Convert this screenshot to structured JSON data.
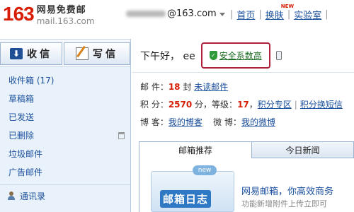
{
  "header": {
    "logo_number": "163",
    "logo_name": "网易免费邮",
    "logo_domain": "mail.163.com",
    "account_domain": "@163.com",
    "links": [
      {
        "label": "首页"
      },
      {
        "label": "换肤",
        "badge": "NEW"
      },
      {
        "label": "实验室"
      }
    ],
    "separator": "|"
  },
  "toolbar": {
    "receive_label": "收信",
    "write_label": "写信"
  },
  "sidebar": {
    "items": [
      {
        "label": "收件箱 (17)"
      },
      {
        "label": "草稿箱"
      },
      {
        "label": "已发送"
      },
      {
        "label": "已删除"
      },
      {
        "label": "垃圾邮件"
      },
      {
        "label": "广告邮件"
      }
    ],
    "contacts_label": "通讯录"
  },
  "main": {
    "greeting": "下午好， ee",
    "security_link": "安全系数高",
    "mail_prefix": "邮 件：",
    "mail_count": "18",
    "mail_unit": " 封 ",
    "unread_link": "未读邮件",
    "points_prefix": "积 分：",
    "points_value": "2570",
    "points_unit": " 分，等级：",
    "level_value": "17",
    "level_suffix": "，",
    "points_zone_link": "积分专区",
    "points_exchange_link": "积分换短信",
    "blog_prefix": "博 客：",
    "blog_link": "我的博客",
    "weibo_prefix": "微 博：",
    "weibo_link": "我的微博"
  },
  "tabs": [
    {
      "label": "邮箱推荐",
      "active": true
    },
    {
      "label": "今日新闻",
      "active": false
    }
  ],
  "promo": {
    "badge": "new",
    "image_text": "邮箱日志",
    "title": "网易邮箱，你高效商务",
    "subtitle": "功能新增附件上传立即可"
  },
  "colors": {
    "brand_red": "#d81e06",
    "link_blue": "#1a4f9c",
    "security_green": "#1a6b1f",
    "highlight_border": "#b0203a"
  },
  "icons": {
    "receive": "inbox-icon",
    "write": "pen-paper-icon",
    "shield": "shield-check-icon",
    "phone": "mobile-phone-icon",
    "trash": "trash-icon",
    "contacts": "person-icon"
  }
}
